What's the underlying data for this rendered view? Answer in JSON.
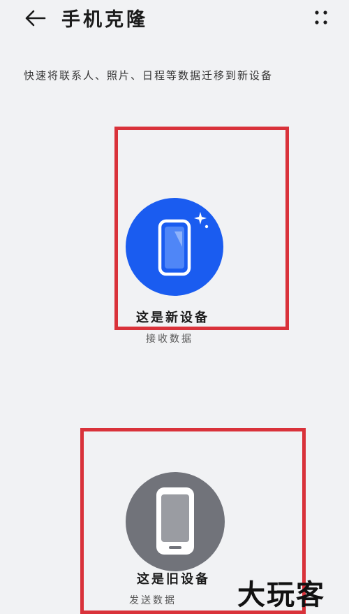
{
  "header": {
    "back_icon": "arrow-left-icon",
    "title": "手机克隆",
    "more_icon": "more-dots-icon"
  },
  "subtitle": "快速将联系人、照片、日程等数据迁移到新设备",
  "options": {
    "new_device": {
      "label": "这是新设备",
      "sublabel": "接收数据",
      "icon": "phone-sparkle-icon",
      "color": "#1a5cf0"
    },
    "old_device": {
      "label": "这是旧设备",
      "sublabel": "发送数据",
      "icon": "phone-icon",
      "color": "#71737a"
    }
  },
  "highlight_color": "#d9323a",
  "watermark": "大玩客"
}
